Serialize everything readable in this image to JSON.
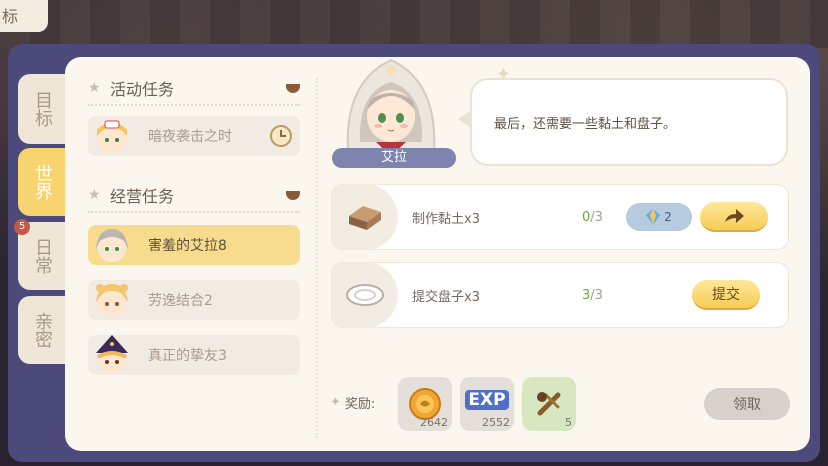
{
  "corner_tab": "标",
  "side_tabs": [
    {
      "label": "目标",
      "active": false
    },
    {
      "label": "世界",
      "active": true
    },
    {
      "label": "日常",
      "active": false,
      "badge": "5"
    },
    {
      "label": "亲密",
      "active": false
    }
  ],
  "sections": [
    {
      "title": "活动任务",
      "tasks": [
        {
          "label": "暗夜袭击之时",
          "active": false,
          "has_timer": true
        }
      ]
    },
    {
      "title": "经营任务",
      "tasks": [
        {
          "label": "害羞的艾拉8",
          "active": true
        },
        {
          "label": "劳逸结合2",
          "active": false
        },
        {
          "label": "真正的挚友3",
          "active": false
        }
      ]
    }
  ],
  "character": {
    "name": "艾拉",
    "dialogue": "最后，还需要一些黏土和盘子。"
  },
  "requirements": [
    {
      "label": "制作黏土x3",
      "have": "0",
      "need": "3",
      "gem_cost": "2",
      "icon": "clay-icon",
      "action": "go"
    },
    {
      "label": "提交盘子x3",
      "have": "3",
      "need": "3",
      "icon": "plate-icon",
      "action_label": "提交"
    }
  ],
  "rewards": {
    "label": "奖励:",
    "items": [
      {
        "icon": "coin-icon",
        "count": "2642"
      },
      {
        "icon": "exp-icon",
        "text": "EXP",
        "count": "2552"
      },
      {
        "icon": "wood-sling-icon",
        "count": "5"
      }
    ],
    "claim_label": "领取"
  },
  "colors": {
    "frame": "#4c4a7a",
    "panel": "#fbf6ee",
    "active_tab": "#f7d470",
    "name_tag": "#7d84ad",
    "progress_done": "#6cab3e"
  }
}
